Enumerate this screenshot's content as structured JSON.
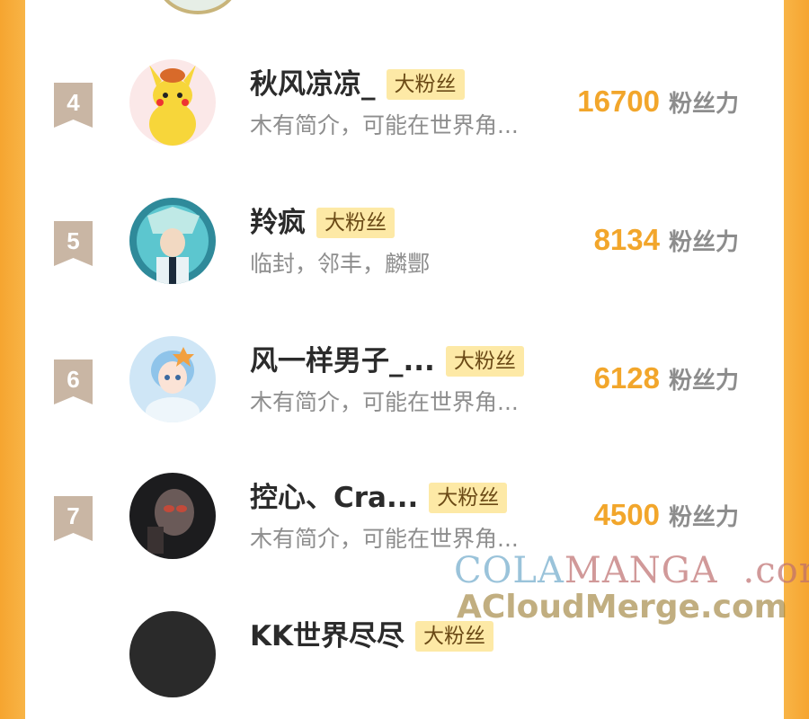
{
  "entries": [
    {
      "rank": "4",
      "name": "秋风凉凉_",
      "badge": "大粉丝",
      "bio": "木有简介，可能在世界角...",
      "score": "16700",
      "unit": "粉丝力"
    },
    {
      "rank": "5",
      "name": "羚疯",
      "badge": "大粉丝",
      "bio": "临封，邻丰，麟酆",
      "score": "8134",
      "unit": "粉丝力"
    },
    {
      "rank": "6",
      "name": "风一样男子_...",
      "badge": "大粉丝",
      "bio": "木有简介，可能在世界角...",
      "score": "6128",
      "unit": "粉丝力"
    },
    {
      "rank": "7",
      "name": "控心、Cra...",
      "badge": "大粉丝",
      "bio": "木有简介，可能在世界角...",
      "score": "4500",
      "unit": "粉丝力"
    },
    {
      "rank": "",
      "name": "KK世界尽尽",
      "badge": "大粉丝",
      "bio": "",
      "score": "",
      "unit": ""
    }
  ],
  "watermark": {
    "part1": "COLA",
    "part2": "MANGA",
    "part3": ".com",
    "line2": "ACloudMerge.com"
  },
  "colors": {
    "score": "#f2a62b",
    "badge_bg": "#fde9a6",
    "border": "#f6a530"
  }
}
